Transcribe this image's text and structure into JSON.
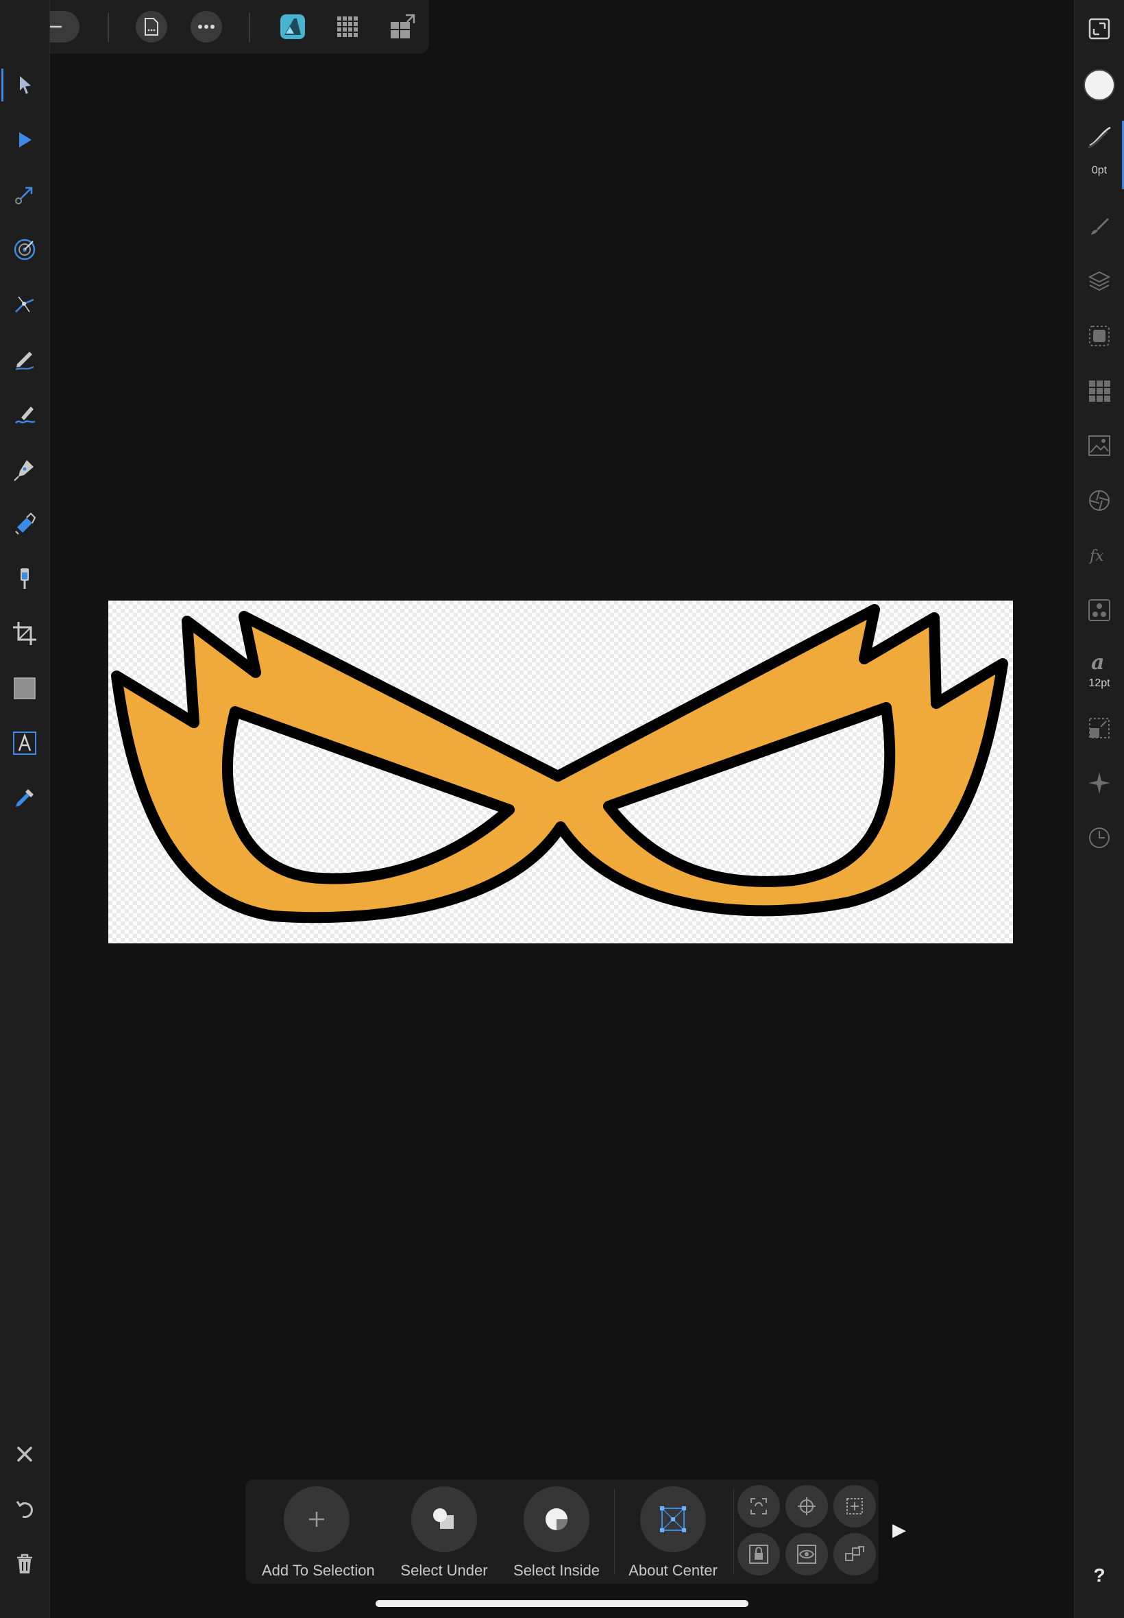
{
  "colors": {
    "canvas_bg": "#121212",
    "panel_bg": "#1e1e1e",
    "accent_blue": "#3b8be6",
    "affinity_logo": "#47b3d1",
    "mask_fill": "#f0aa3c",
    "mask_outline": "#000000"
  },
  "top_toolbar": {
    "buttons": [
      {
        "name": "back-arrow-icon"
      },
      {
        "name": "document-icon"
      },
      {
        "name": "more-ellipsis-icon"
      },
      {
        "name": "affinity-designer-persona-icon"
      },
      {
        "name": "pixel-persona-icon"
      },
      {
        "name": "export-persona-icon"
      }
    ]
  },
  "left_tools": [
    "move-tool-icon",
    "node-tool-icon",
    "point-transform-tool-icon",
    "corner-tool-icon",
    "contour-tool-icon",
    "pencil-tool-icon",
    "vector-brush-tool-icon",
    "pen-tool-icon",
    "fill-tool-icon",
    "transparency-tool-icon",
    "crop-tool-icon",
    "rectangle-tool-icon",
    "artistic-text-tool-icon",
    "color-picker-tool-icon"
  ],
  "left_bottom": [
    "close-icon",
    "undo-icon",
    "delete-icon"
  ],
  "right_panel": {
    "stroke_width": "0pt",
    "font_size": "12pt",
    "studios": [
      "fill-color-icon",
      "stroke-icon",
      "brushes-icon",
      "layers-icon",
      "appearance-icon",
      "swatches-icon",
      "assets-icon",
      "adjustments-icon",
      "effects-icon",
      "styles-icon",
      "text-styles-icon",
      "transform-icon",
      "navigator-icon",
      "history-icon"
    ],
    "help": "?"
  },
  "context_toolbar": {
    "add_to_selection": "Add To Selection",
    "select_under": "Select Under",
    "select_inside": "Select Inside",
    "about_center": "About Center",
    "expand": "▶"
  }
}
